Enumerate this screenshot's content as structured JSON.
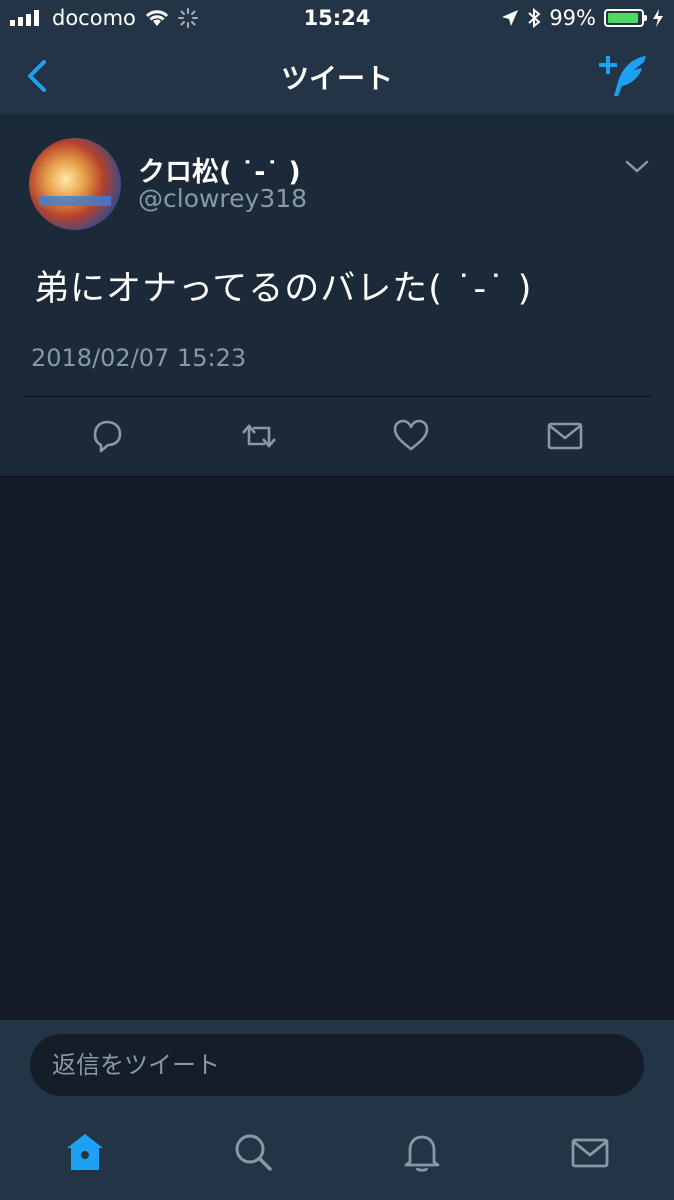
{
  "status_bar": {
    "carrier": "docomo",
    "time": "15:24",
    "battery_percent": "99%",
    "battery_level": 0.99
  },
  "nav": {
    "title": "ツイート",
    "back_icon": "chevron-left-icon",
    "compose_icon": "compose-tweet-icon"
  },
  "tweet": {
    "display_name": "クロ松( ˙-˙ )",
    "handle": "@clowrey318",
    "text": "弟にオナってるのバレた( ˙-˙ )",
    "timestamp": "2018/02/07 15:23",
    "actions": [
      "reply-icon",
      "retweet-icon",
      "like-icon",
      "direct-message-icon"
    ]
  },
  "reply": {
    "placeholder": "返信をツイート"
  },
  "tabs": [
    {
      "name": "home-icon",
      "active": true
    },
    {
      "name": "search-icon",
      "active": false
    },
    {
      "name": "notifications-icon",
      "active": false
    },
    {
      "name": "messages-icon",
      "active": false
    }
  ],
  "colors": {
    "accent": "#1da1f2",
    "background": "#151c27",
    "card": "#1c2938",
    "bar": "#243447",
    "secondary_text": "#8899a6"
  }
}
